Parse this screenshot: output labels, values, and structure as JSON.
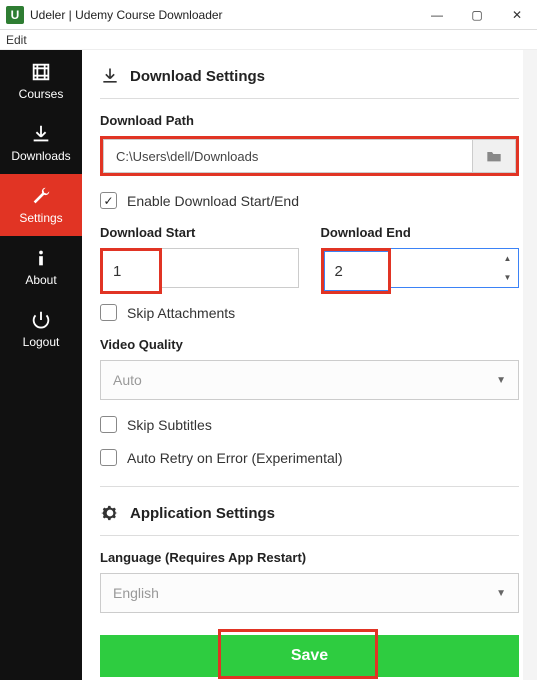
{
  "titlebar": {
    "title": "Udeler | Udemy Course Downloader",
    "app_badge": "U"
  },
  "menubar": {
    "edit": "Edit"
  },
  "sidebar": {
    "items": [
      {
        "label": "Courses"
      },
      {
        "label": "Downloads"
      },
      {
        "label": "Settings"
      },
      {
        "label": "About"
      },
      {
        "label": "Logout"
      }
    ]
  },
  "download_settings": {
    "heading": "Download Settings",
    "path_label": "Download Path",
    "path_value": "C:\\Users\\dell/Downloads",
    "enable_label": "Enable Download Start/End",
    "start_label": "Download Start",
    "start_value": "1",
    "end_label": "Download End",
    "end_value": "2",
    "skip_attachments": "Skip Attachments",
    "video_quality_label": "Video Quality",
    "video_quality_value": "Auto",
    "skip_subtitles": "Skip Subtitles",
    "auto_retry": "Auto Retry on Error (Experimental)"
  },
  "app_settings": {
    "heading": "Application Settings",
    "language_label": "Language (Requires App Restart)",
    "language_value": "English"
  },
  "actions": {
    "save": "Save"
  }
}
